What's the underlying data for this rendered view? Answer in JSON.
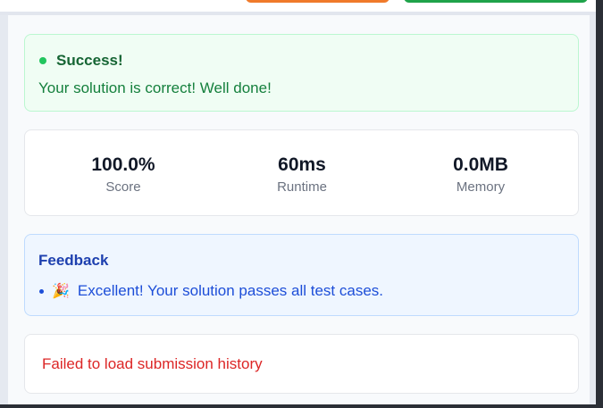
{
  "result": {
    "status_title": "Success!",
    "status_message": "Your solution is correct! Well done!",
    "status_color": "#22c55e"
  },
  "stats": [
    {
      "value": "100.0%",
      "label": "Score"
    },
    {
      "value": "60ms",
      "label": "Runtime"
    },
    {
      "value": "0.0MB",
      "label": "Memory"
    }
  ],
  "feedback": {
    "title": "Feedback",
    "items": [
      {
        "icon": "party-popper-icon",
        "text": "Excellent! Your solution passes all test cases."
      }
    ]
  },
  "history": {
    "error": "Failed to load submission history"
  },
  "colors": {
    "success_bg": "#f0fdf4",
    "feedback_bg": "#eff6ff",
    "error_text": "#dc2626",
    "orange_button": "#f07a2a",
    "green_button": "#1fa34a"
  }
}
